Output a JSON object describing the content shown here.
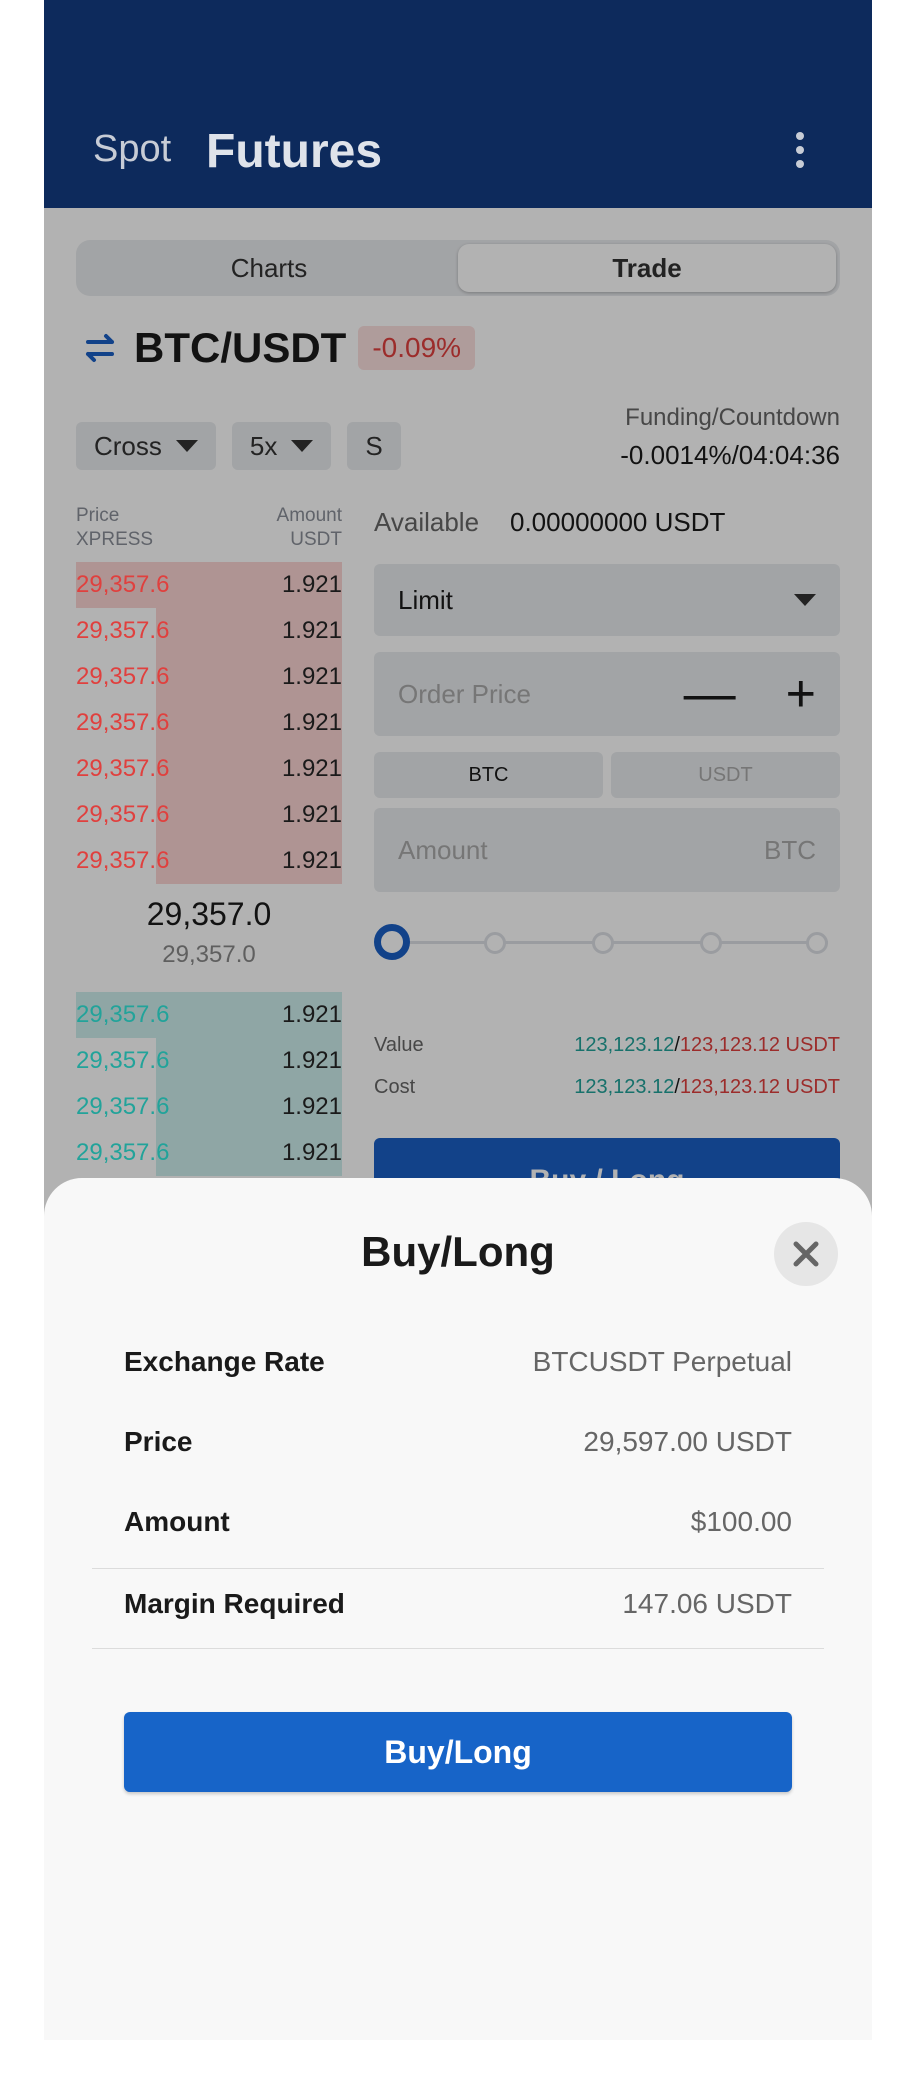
{
  "header": {
    "tab_spot": "Spot",
    "tab_futures": "Futures",
    "menu_icon": "more-vertical-icon"
  },
  "segment": {
    "charts": "Charts",
    "trade": "Trade",
    "active": "Trade"
  },
  "pair": {
    "name": "BTC/USDT",
    "change": "-0.09%",
    "icon": "swap-icon"
  },
  "controls": {
    "margin_mode": "Cross",
    "leverage": "5x",
    "extra": "S"
  },
  "funding": {
    "label": "Funding/Countdown",
    "value": "-0.0014%/04:04:36"
  },
  "orderbook": {
    "price_label": "Price",
    "price_unit": "XPRESS",
    "amount_label": "Amount",
    "amount_unit": "USDT",
    "asks": [
      {
        "price": "29,357.6",
        "amount": "1.921",
        "depth": 1.0
      },
      {
        "price": "29,357.6",
        "amount": "1.921",
        "depth": 0.7
      },
      {
        "price": "29,357.6",
        "amount": "1.921",
        "depth": 0.7
      },
      {
        "price": "29,357.6",
        "amount": "1.921",
        "depth": 0.7
      },
      {
        "price": "29,357.6",
        "amount": "1.921",
        "depth": 0.7
      },
      {
        "price": "29,357.6",
        "amount": "1.921",
        "depth": 0.7
      },
      {
        "price": "29,357.6",
        "amount": "1.921",
        "depth": 0.7
      }
    ],
    "mid_price": "29,357.0",
    "mark_price": "29,357.0",
    "bids": [
      {
        "price": "29,357.6",
        "amount": "1.921",
        "depth": 1.0
      },
      {
        "price": "29,357.6",
        "amount": "1.921",
        "depth": 0.7
      },
      {
        "price": "29,357.6",
        "amount": "1.921",
        "depth": 0.7
      },
      {
        "price": "29,357.6",
        "amount": "1.921",
        "depth": 0.7
      }
    ]
  },
  "form": {
    "available_label": "Available",
    "available_value": "0.00000000 USDT",
    "order_type": "Limit",
    "order_price_placeholder": "Order Price",
    "unit_btc": "BTC",
    "unit_usdt": "USDT",
    "amount_placeholder": "Amount",
    "amount_unit": "BTC",
    "slider_level": 0,
    "value_label": "Value",
    "value_green": "123,123.12",
    "value_red": "123,123.12 USDT",
    "cost_label": "Cost",
    "cost_green": "123,123.12",
    "cost_red": "123,123.12 USDT",
    "submit_label": "Buy / Long"
  },
  "sheet": {
    "title": "Buy/Long",
    "rows": [
      {
        "label": "Exchange Rate",
        "value": "BTCUSDT Perpetual"
      },
      {
        "label": "Price",
        "value": "29,597.00 USDT"
      },
      {
        "label": "Amount",
        "value": "$100.00"
      },
      {
        "label": "Margin Required",
        "value": "147.06 USDT"
      }
    ],
    "confirm_label": "Buy/Long"
  },
  "colors": {
    "header_bg": "#0d2a5c",
    "primary": "#1764c8",
    "sell": "#e0403e",
    "buy": "#22a39a"
  }
}
